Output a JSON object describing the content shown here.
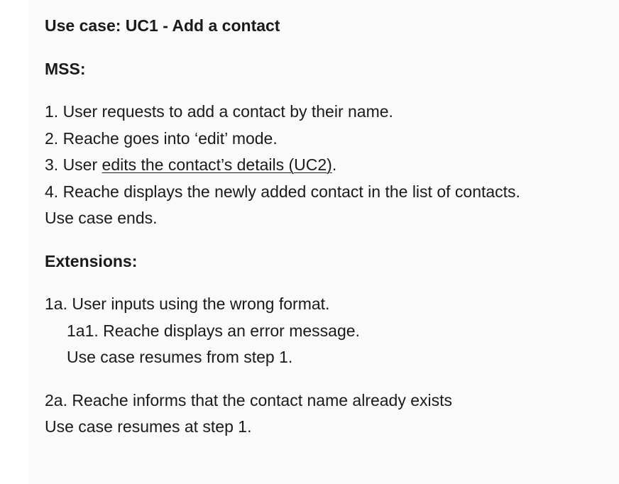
{
  "title": "Use case: UC1 - Add a contact",
  "mss": {
    "heading": "MSS:",
    "step1": "1. User requests to add a contact by their name.",
    "step2": "2. Reache goes into ‘edit’ mode.",
    "step3_prefix": "3. User ",
    "step3_link": "edits the contact’s details (UC2)",
    "step3_suffix": ".",
    "step4": "4. Reache displays the newly added contact in the list of contacts.",
    "end": "Use case ends."
  },
  "extensions": {
    "heading": "Extensions:",
    "ext1a": "1a. User inputs using the wrong format.",
    "ext1a1": "1a1. Reache displays an error message.",
    "ext1a_resume": "Use case resumes from step 1.",
    "ext2a": "2a. Reache informs that the contact name already exists",
    "ext2a_resume": "Use case resumes at step 1."
  }
}
